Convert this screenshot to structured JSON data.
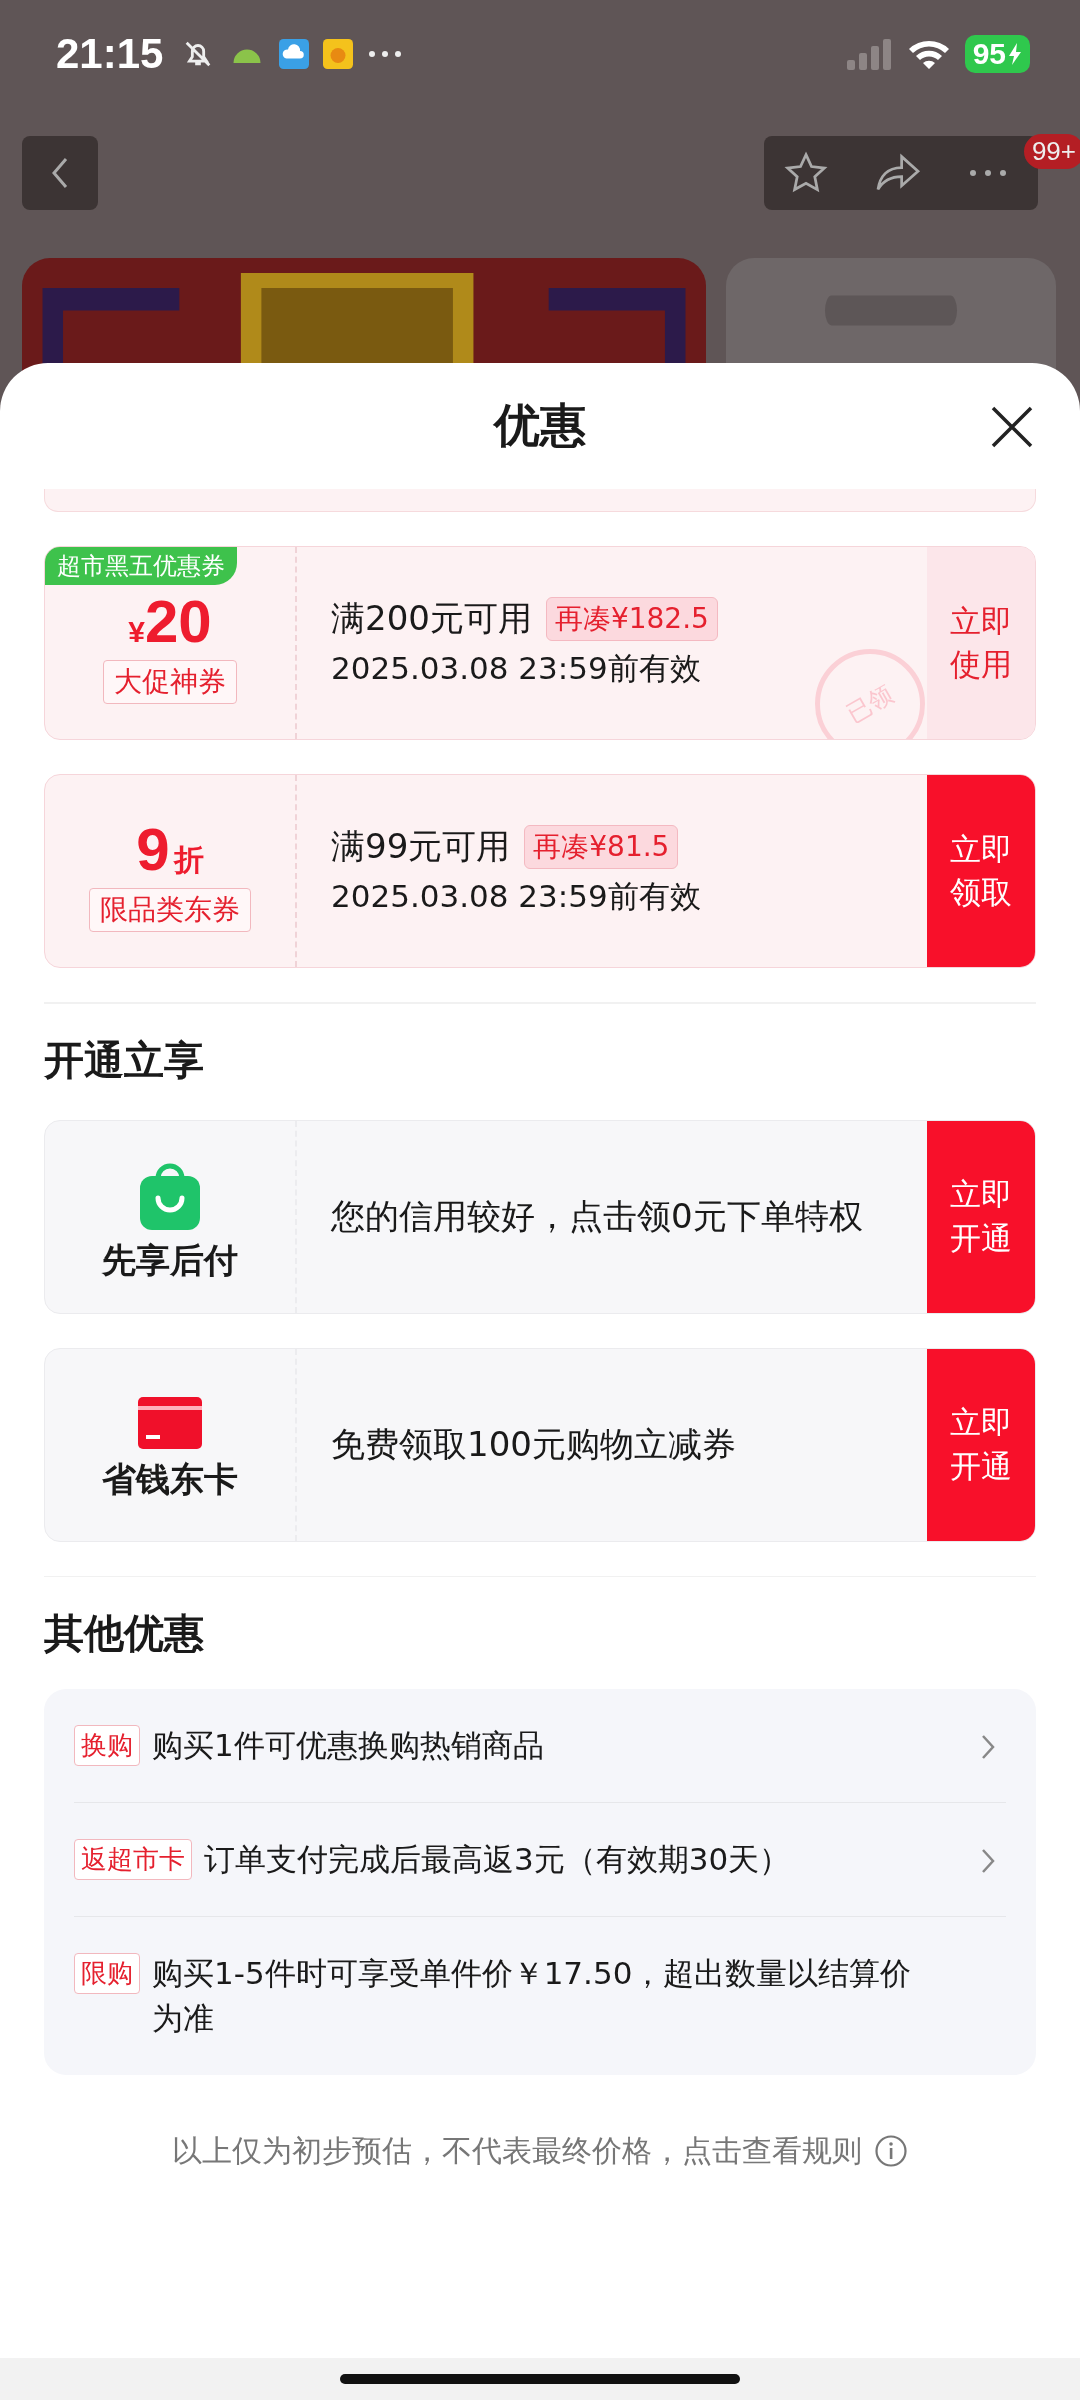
{
  "status_bar": {
    "time": "21:15",
    "battery": "95"
  },
  "nav": {
    "badge": "99+"
  },
  "sheet": {
    "title": "优惠",
    "coupons": [
      {
        "kind": "amount",
        "ribbon": "超市黑五优惠券",
        "symbol": "¥",
        "value": "20",
        "tag": "大促神券",
        "condition": "满200元可用",
        "gap": "再凑¥182.5",
        "validity": "2025.03.08 23:59前有效",
        "button": "立即使用",
        "claimed": true,
        "stamp": "已领"
      },
      {
        "kind": "discount",
        "value": "9",
        "unit": "折",
        "tag": "限品类东券",
        "condition": "满99元可用",
        "gap": "再凑¥81.5",
        "validity": "2025.03.08 23:59前有效",
        "button": "立即领取",
        "claimed": false
      }
    ],
    "services_title": "开通立享",
    "services": [
      {
        "kind": "bag",
        "name": "先享后付",
        "text": "您的信用较好，点击领0元下单特权",
        "button": "立即开通"
      },
      {
        "kind": "card",
        "name": "省钱东卡",
        "text": "免费领取100元购物立减券",
        "button": "立即开通"
      }
    ],
    "others_title": "其他优惠",
    "others": [
      {
        "tag": "换购",
        "text": "购买1件可优惠换购热销商品",
        "arrow": true
      },
      {
        "tag": "返超市卡",
        "text": "订单支付完成后最高返3元（有效期30天）",
        "arrow": true
      },
      {
        "tag": "限购",
        "text": "购买1-5件时可享受单件价￥17.50，超出数量以结算价为准",
        "arrow": false
      }
    ],
    "footnote": "以上仅为初步预估，不代表最终价格，点击查看规则"
  }
}
